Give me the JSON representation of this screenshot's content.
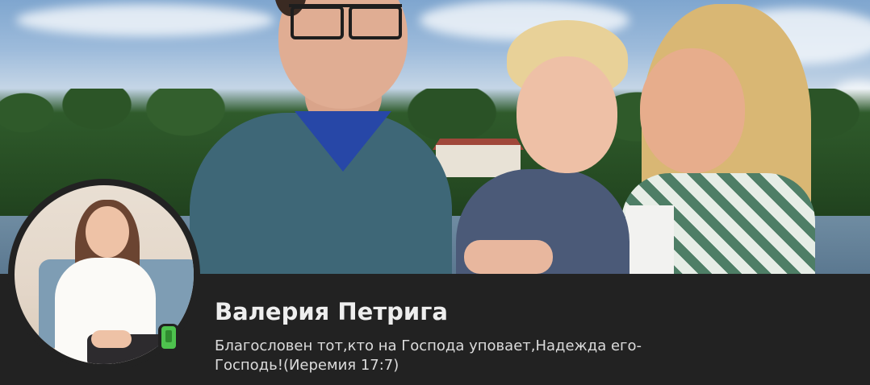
{
  "profile": {
    "name": "Валерия Петрига",
    "status": "Благословен тот,кто на Господа уповает,Надежда его-Господь!(Иеремия 17:7)"
  },
  "status_badge": {
    "icon": "mobile-phone-icon",
    "color": "#4ec24e"
  },
  "colors": {
    "header_bg": "#222222",
    "name_text": "#eeeeee",
    "status_text": "#dcdcdc"
  }
}
